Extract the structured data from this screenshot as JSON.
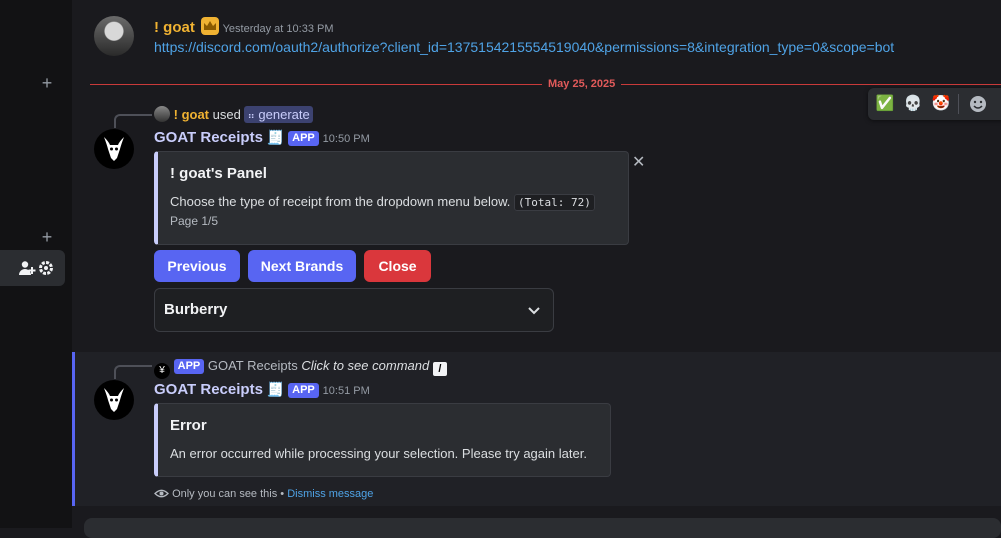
{
  "messages": {
    "first": {
      "author": "! goat",
      "timestamp": "Yesterday at 10:33 PM",
      "link": "https://discord.com/oauth2/authorize?client_id=1375154215554519040&permissions=8&integration_type=0&scope=bot"
    },
    "date_separator": "May 25, 2025",
    "second": {
      "reply_user": "! goat",
      "reply_used": "used",
      "reply_command": "generate",
      "author": "GOAT Receipts",
      "app_badge": "APP",
      "timestamp": "10:50 PM",
      "embed": {
        "title": "! goat's Panel",
        "description": "Choose the type of receipt from the dropdown menu below.",
        "code": "(Total: 72)",
        "footer": "Page 1/5"
      },
      "buttons": {
        "previous": "Previous",
        "next": "Next Brands",
        "close": "Close"
      },
      "select_value": "Burberry"
    },
    "third": {
      "reply_badge": "APP",
      "reply_app": "GOAT Receipts",
      "reply_text": "Click to see command",
      "author": "GOAT Receipts",
      "app_badge": "APP",
      "timestamp": "10:51 PM",
      "embed": {
        "title": "Error",
        "description": "An error occurred while processing your selection. Please try again later."
      },
      "ephemeral_note": "Only you can see this",
      "ephemeral_sep": " • ",
      "dismiss": "Dismiss message"
    }
  },
  "reactions": [
    "✅",
    "💀",
    "🤡"
  ],
  "colors": {
    "accent": "#5865f2",
    "danger": "#da373c",
    "gold": "#f0b232",
    "link": "#4fa3e6"
  },
  "icons": [
    "plus-icon",
    "add-member-icon",
    "gear-icon",
    "crown-icon",
    "receipt-icon",
    "close-icon",
    "chevron-down-icon",
    "eye-icon",
    "add-reaction-icon",
    "slash-command-icon",
    "goat-logo-icon"
  ]
}
